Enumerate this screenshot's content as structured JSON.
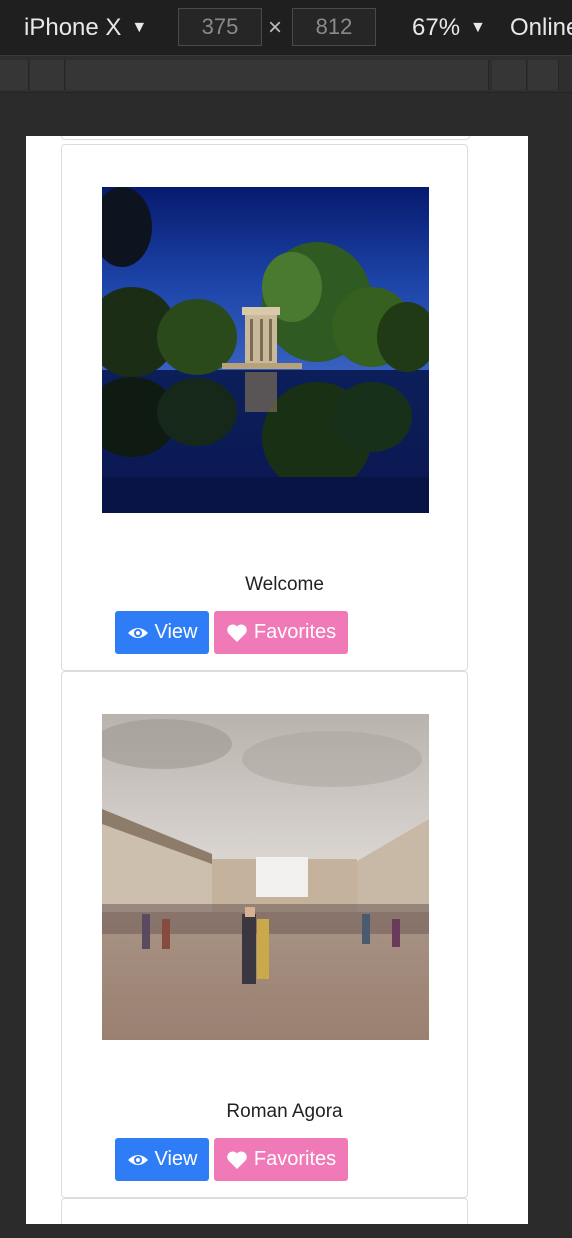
{
  "devtools": {
    "device_name": "iPhone X",
    "width_value": "375",
    "height_value": "812",
    "times_symbol": "×",
    "zoom": "67%",
    "network": "Online",
    "caret": "▼"
  },
  "cards": [
    {
      "title": "Welcome",
      "view_label": "View",
      "favorites_label": "Favorites"
    },
    {
      "title": "Roman Agora",
      "view_label": "View",
      "favorites_label": "Favorites"
    }
  ],
  "colors": {
    "view_button": "#2f7df6",
    "favorites_button": "#f07ab8"
  }
}
